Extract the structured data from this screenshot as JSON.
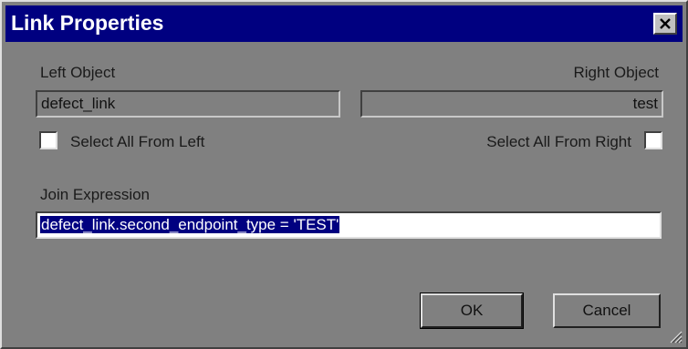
{
  "dialog": {
    "title": "Link Properties"
  },
  "left_object": {
    "label": "Left Object",
    "value": "defect_link",
    "select_all_label": "Select All From Left",
    "select_all_checked": false
  },
  "right_object": {
    "label": "Right Object",
    "value": "test",
    "select_all_label": "Select All From Right",
    "select_all_checked": false
  },
  "join_expression": {
    "label": "Join Expression",
    "value": "defect_link.second_endpoint_type = 'TEST'"
  },
  "buttons": {
    "ok_label": "OK",
    "cancel_label": "Cancel"
  },
  "colors": {
    "titlebar": "#000080",
    "dialog_bg": "#808080",
    "selection": "#000080"
  },
  "icons": {
    "close": "close-icon",
    "resize": "resize-grip-icon"
  }
}
